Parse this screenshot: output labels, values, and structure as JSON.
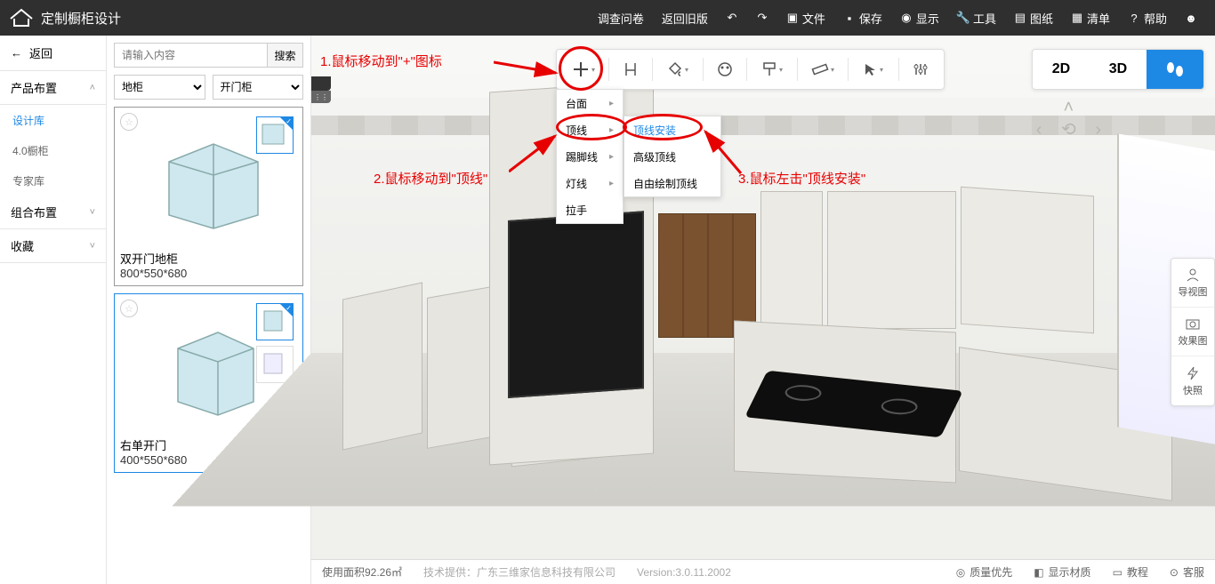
{
  "header": {
    "app_title": "定制橱柜设计",
    "menu": {
      "survey": "调查问卷",
      "oldver": "返回旧版",
      "file": "文件",
      "save": "保存",
      "display": "显示",
      "tools": "工具",
      "drawings": "图纸",
      "list": "清单",
      "help": "帮助"
    }
  },
  "leftnav": {
    "back": "返回",
    "section1": "产品布置",
    "items1": {
      "design_lib": "设计库",
      "cab40": "4.0橱柜",
      "expert_lib": "专家库"
    },
    "section2": "组合布置",
    "section3": "收藏"
  },
  "catalog": {
    "search_placeholder": "请输入内容",
    "search_btn": "搜索",
    "select1": "地柜",
    "select2": "开门柜",
    "card1": {
      "name": "双开门地柜",
      "dims": "800*550*680"
    },
    "card2": {
      "name": "右单开门",
      "dims": "400*550*680"
    }
  },
  "toolbar_menu": {
    "lv1": {
      "taimian": "台面",
      "dingxian": "顶线",
      "tijiaoxian": "踢脚线",
      "dengxian": "灯线",
      "lashou": "拉手"
    },
    "lv2": {
      "install": "顶线安装",
      "adv": "高级顶线",
      "free": "自由绘制顶线"
    }
  },
  "viewmodes": {
    "v2d": "2D",
    "v3d": "3D"
  },
  "annotations": {
    "a1": "1.鼠标移动到\"+\"图标",
    "a2": "2.鼠标移动到\"顶线\"",
    "a3": "3.鼠标左击\"顶线安装\""
  },
  "rightrail": {
    "nav": "导视图",
    "render": "效果图",
    "snap": "快照"
  },
  "status": {
    "area": "使用面积92.26㎡",
    "tech": "技术提供：广东三维家信息科技有限公司",
    "version": "Version:3.0.11.2002",
    "quality": "质量优先",
    "material": "显示材质",
    "tutorial": "教程",
    "service": "客服"
  }
}
